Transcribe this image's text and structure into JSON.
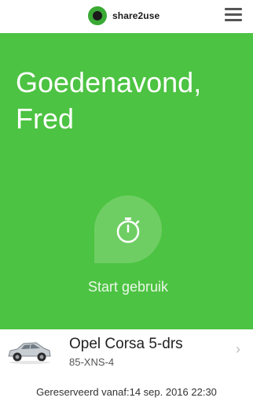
{
  "header": {
    "brand": "share2use",
    "menu_icon": "hamburger-icon"
  },
  "hero": {
    "greeting_line1": "Goedenavond,",
    "greeting_line2": "Fred",
    "background_color": "#4cc342",
    "start_icon": "stopwatch-icon",
    "start_label": "Start gebruik"
  },
  "vehicle": {
    "name": "Opel Corsa 5-drs",
    "plate": "85-XNS-4",
    "icon": "car-icon",
    "chevron_icon": "chevron-right-icon"
  },
  "reservation": {
    "text": "Gereserveerd vanaf:14 sep. 2016 22:30"
  }
}
